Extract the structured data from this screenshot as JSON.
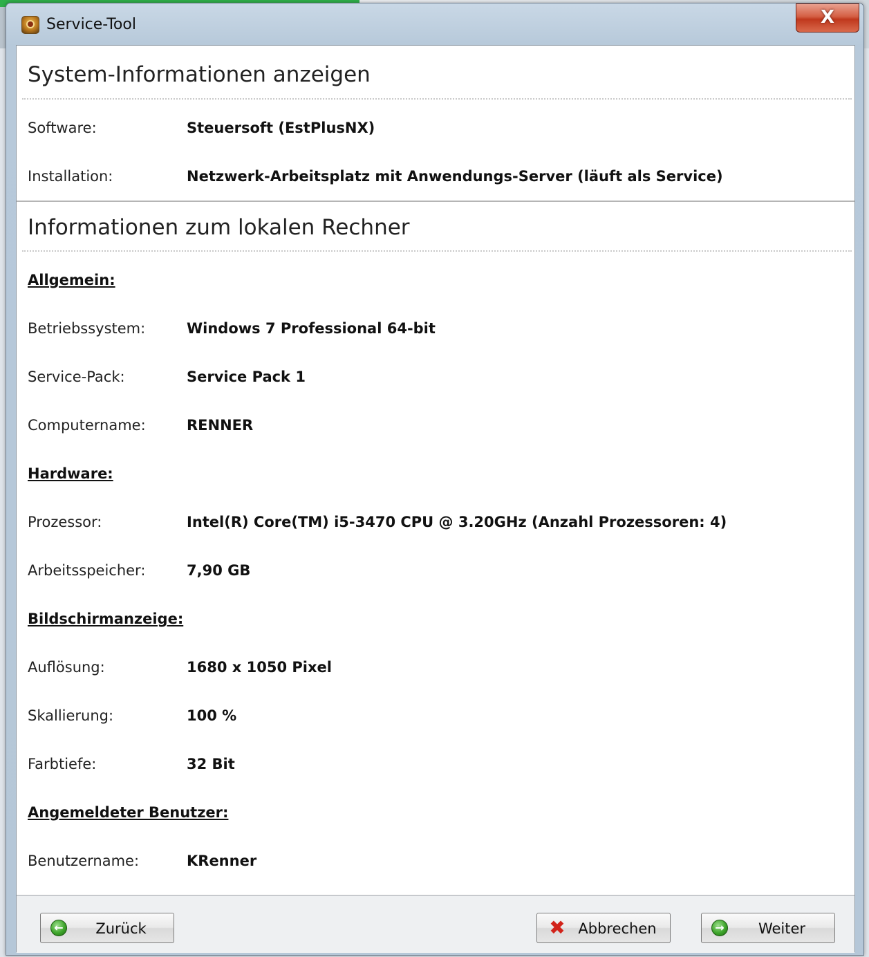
{
  "window": {
    "title": "Service-Tool",
    "close_symbol": "X"
  },
  "system_section": {
    "title": "System-Informationen anzeigen",
    "rows": [
      {
        "label": "Software:",
        "value": "Steuersoft (EstPlusNX)"
      },
      {
        "label": "Installation:",
        "value": "Netzwerk-Arbeitsplatz mit Anwendungs-Server (läuft als Service)"
      }
    ]
  },
  "local_section": {
    "title": "Informationen zum lokalen Rechner",
    "groups": {
      "allgemein": {
        "heading": "Allgemein:",
        "rows": [
          {
            "label": "Betriebssystem:",
            "value": "Windows 7 Professional 64-bit"
          },
          {
            "label": "Service-Pack:",
            "value": "Service Pack 1"
          },
          {
            "label": "Computername:",
            "value": "RENNER"
          }
        ]
      },
      "hardware": {
        "heading": "Hardware:",
        "rows": [
          {
            "label": "Prozessor:",
            "value": "Intel(R) Core(TM) i5-3470 CPU @ 3.20GHz (Anzahl Prozessoren: 4)"
          },
          {
            "label": "Arbeitsspeicher:",
            "value": "7,90 GB"
          }
        ]
      },
      "bildschirm": {
        "heading": "Bildschirmanzeige:",
        "rows": [
          {
            "label": "Auflösung:",
            "value": "1680 x 1050 Pixel"
          },
          {
            "label": "Skallierung:",
            "value": "100 %"
          },
          {
            "label": "Farbtiefe:",
            "value": "32 Bit"
          }
        ]
      },
      "benutzer": {
        "heading": "Angemeldeter Benutzer:",
        "rows": [
          {
            "label": "Benutzername:",
            "value": "KRenner"
          }
        ]
      }
    }
  },
  "footer": {
    "back_label": "Zurück",
    "cancel_label": "Abbrechen",
    "next_label": "Weiter"
  },
  "colors": {
    "accent_green": "#3ea52b",
    "cancel_red": "#d2231a",
    "close_red": "#c0381d"
  }
}
